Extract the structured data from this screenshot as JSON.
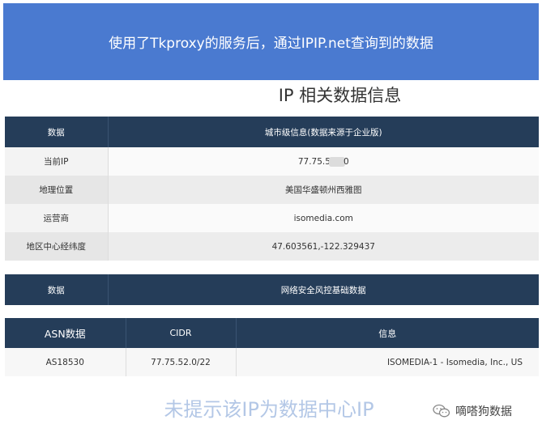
{
  "banner": {
    "text": "使用了Tkproxy的服务后，通过IPIP.net查询到的数据"
  },
  "page_title": "IP 相关数据信息",
  "city_table": {
    "header_left": "数据",
    "header_right": "城市级信息(数据来源于企业版)",
    "rows": [
      {
        "label": "当前IP",
        "value_prefix": "77.75.5",
        "value_suffix": "0"
      },
      {
        "label": "地理位置",
        "value": "美国华盛顿州西雅图"
      },
      {
        "label": "运营商",
        "value": "isomedia.com"
      },
      {
        "label": "地区中心经纬度",
        "value": "47.603561,-122.329437"
      }
    ]
  },
  "risk_table": {
    "header_left": "数据",
    "header_right": "网络安全风控基础数据"
  },
  "asn_table": {
    "headers": [
      "ASN数据",
      "CIDR",
      "信息"
    ],
    "row": [
      "AS18530",
      "77.75.52.0/22",
      "ISOMEDIA-1 - Isomedia, Inc., US"
    ]
  },
  "footnote": "未提示该IP为数据中心IP",
  "watermark": {
    "text": "嘀嗒狗数据",
    "icon": "wechat-icon"
  }
}
